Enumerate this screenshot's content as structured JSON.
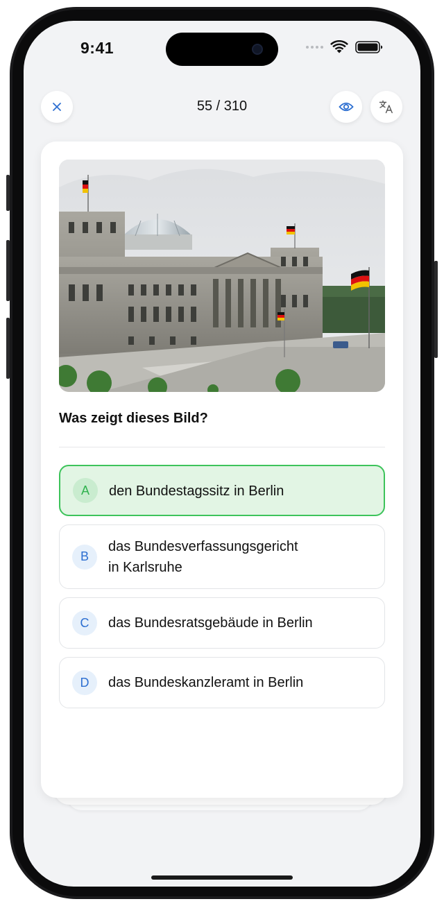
{
  "status": {
    "time": "9:41"
  },
  "header": {
    "counter": "55 / 310"
  },
  "question": {
    "image_alt": "Reichstag building in Berlin with German flags",
    "text": "Was zeigt dieses Bild?"
  },
  "options": [
    {
      "letter": "A",
      "line1": "den Bundestagssitz in Berlin",
      "line2": "",
      "selected": true
    },
    {
      "letter": "B",
      "line1": "das Bundesverfassungsgericht",
      "line2": "in Karlsruhe",
      "selected": false
    },
    {
      "letter": "C",
      "line1": "das Bundesratsgebäude in Berlin",
      "line2": "",
      "selected": false
    },
    {
      "letter": "D",
      "line1": "das Bundeskanzleramt in Berlin",
      "line2": "",
      "selected": false
    }
  ],
  "icons": {
    "close": "close-icon",
    "reveal": "eye-icon",
    "translate": "translate-icon"
  },
  "colors": {
    "accent_blue": "#2d6fd1",
    "correct_green": "#3cc35a",
    "correct_bg": "#e2f5e4",
    "screen_bg": "#f2f3f5"
  }
}
